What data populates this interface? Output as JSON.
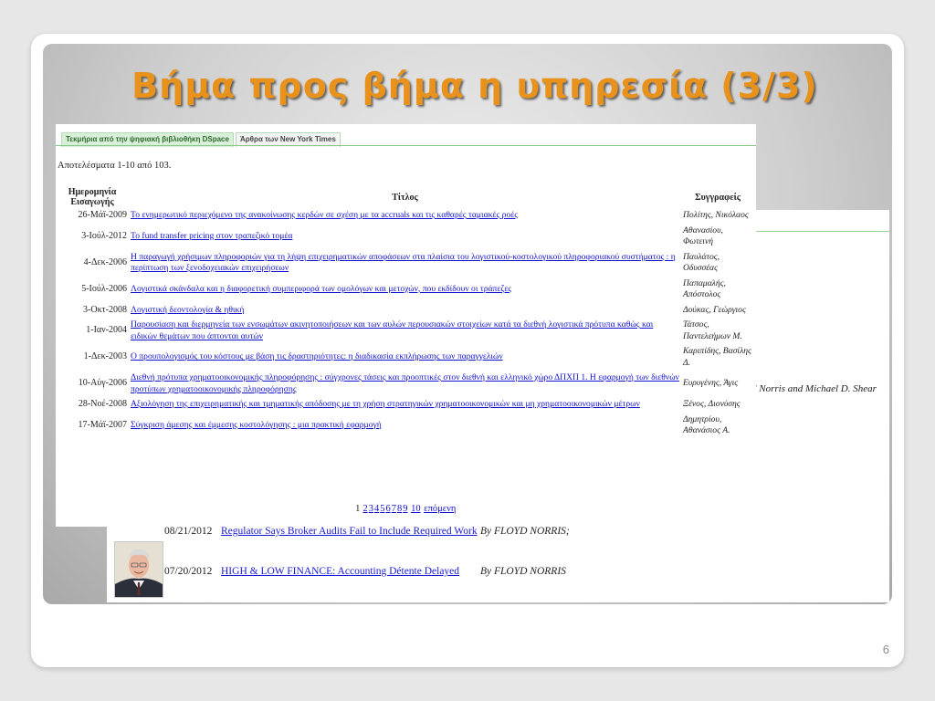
{
  "slide": {
    "title": "Βήμα προς βήμα η υπηρεσία (3/3)",
    "page_number": "6"
  },
  "dspace": {
    "tabs": [
      "Τεκμήρια από την ψηφιακή βιβλιοθήκη DSpace",
      "Άρθρα των New York Times"
    ],
    "results_count": "Αποτελέσματα 1-10 από 103.",
    "headers": {
      "date": "Ημερομηνία Εισαγωγής",
      "title": "Τίτλος",
      "authors": "Συγγραφείς"
    },
    "rows": [
      {
        "date": "26-Μάϊ-2009",
        "title": "Το ενημερωτικό περιεχόμενο της ανακοίνωσης κερδών σε σχέση με τα accruals και τις καθαρές ταμιακές ροές",
        "authors": "Πολίτης, Νικόλαος"
      },
      {
        "date": "3-Ιούλ-2012",
        "title": "Το fund transfer pricing στον τραπεζικό τομέα",
        "authors": "Αθανασίου, Φωτεινή"
      },
      {
        "date": "4-Δεκ-2006",
        "title": "Η παραγωγή χρήσιμων πληροφοριών για τη λήψη επιχειρηματικών αποφάσεων στα πλαίσια του λογιστικού-κοστολογικού πληροφοριακού συστήματος : η περίπτωση των ξενοδοχειακών επιχειρήσεων",
        "authors": "Παυλάτος, Οδυσσέας"
      },
      {
        "date": "5-Ιούλ-2006",
        "title": "Λογιστικά σκάνδαλα και η διαφορετική συμπεριφορά των ομολόγων και μετοχών, που εκδίδουν οι τράπεζες",
        "authors": "Παπαμαλής, Απόστολος"
      },
      {
        "date": "3-Οκτ-2008",
        "title": "Λογιστική δεοντολογία & ηθική",
        "authors": "Δούκας, Γεώργιος"
      },
      {
        "date": "1-Ιαν-2004",
        "title": "Παρουσίαση και διερμηνεία των ενσωμάτων ακινητοποιήσεων και των αυλών περουσιακών στοιχείων κατά τα διεθνή λογιστικά πρότυπα καθώς και ειδικών θεμάτων που άπτονται αυτών",
        "authors": "Τάτσος, Παντελεήμων Μ."
      },
      {
        "date": "1-Δεκ-2003",
        "title": "Ο προυπολογισμός του κόστους με βάση τις δραστηριότητες: η διαδικασία εκπλήρωσης των παραγγελιών",
        "authors": "Καριπίδης, Βασίλης Δ."
      },
      {
        "date": "10-Αύγ-2006",
        "title": "Διεθνή πρότυπα χρηματοοικονομικής πληροφόρησης : σύγχρονες τάσεις και προοπτικές στον διεθνή και ελληνικό χώρο ΔΠΧΠ 1. Η εφαρμογή των διεθνών προτύπων χρηματοοικονομικής πληροφόρησης",
        "authors": "Ευρυγένης, Άγις"
      },
      {
        "date": "28-Νοέ-2008",
        "title": "Αξιολόγηση της επιχειρηματικής και τμηματικής απόδοσης με τη χρήση στρατηγικών χρηματοοικονομικών και μη χρηματοοικονομικών μέτρων",
        "authors": "Ξένος, Διονύσης"
      },
      {
        "date": "17-Μάϊ-2007",
        "title": "Σύγκριση άμεσης και έμμεσης κοστολόγησης : μια πρακτική εφαρμογή",
        "authors": "Δημητρίου, Αθανάσιος Α."
      }
    ],
    "pagination": {
      "current": "1",
      "pages": [
        "2",
        "3",
        "4",
        "5",
        "6",
        "7",
        "8",
        "9",
        "10"
      ],
      "next": "επόμενη"
    }
  },
  "nyt": {
    "snippet": "d Norris and Michael D. Shear",
    "rows": [
      {
        "date": "08/21/2012",
        "title": "Regulator Says Broker Audits Fail to Include Required Work",
        "author": "By FLOYD NORRIS;"
      },
      {
        "date": "07/20/2012",
        "title": "HIGH & LOW FINANCE: Accounting Détente Delayed",
        "author": "By FLOYD NORRIS"
      }
    ]
  }
}
